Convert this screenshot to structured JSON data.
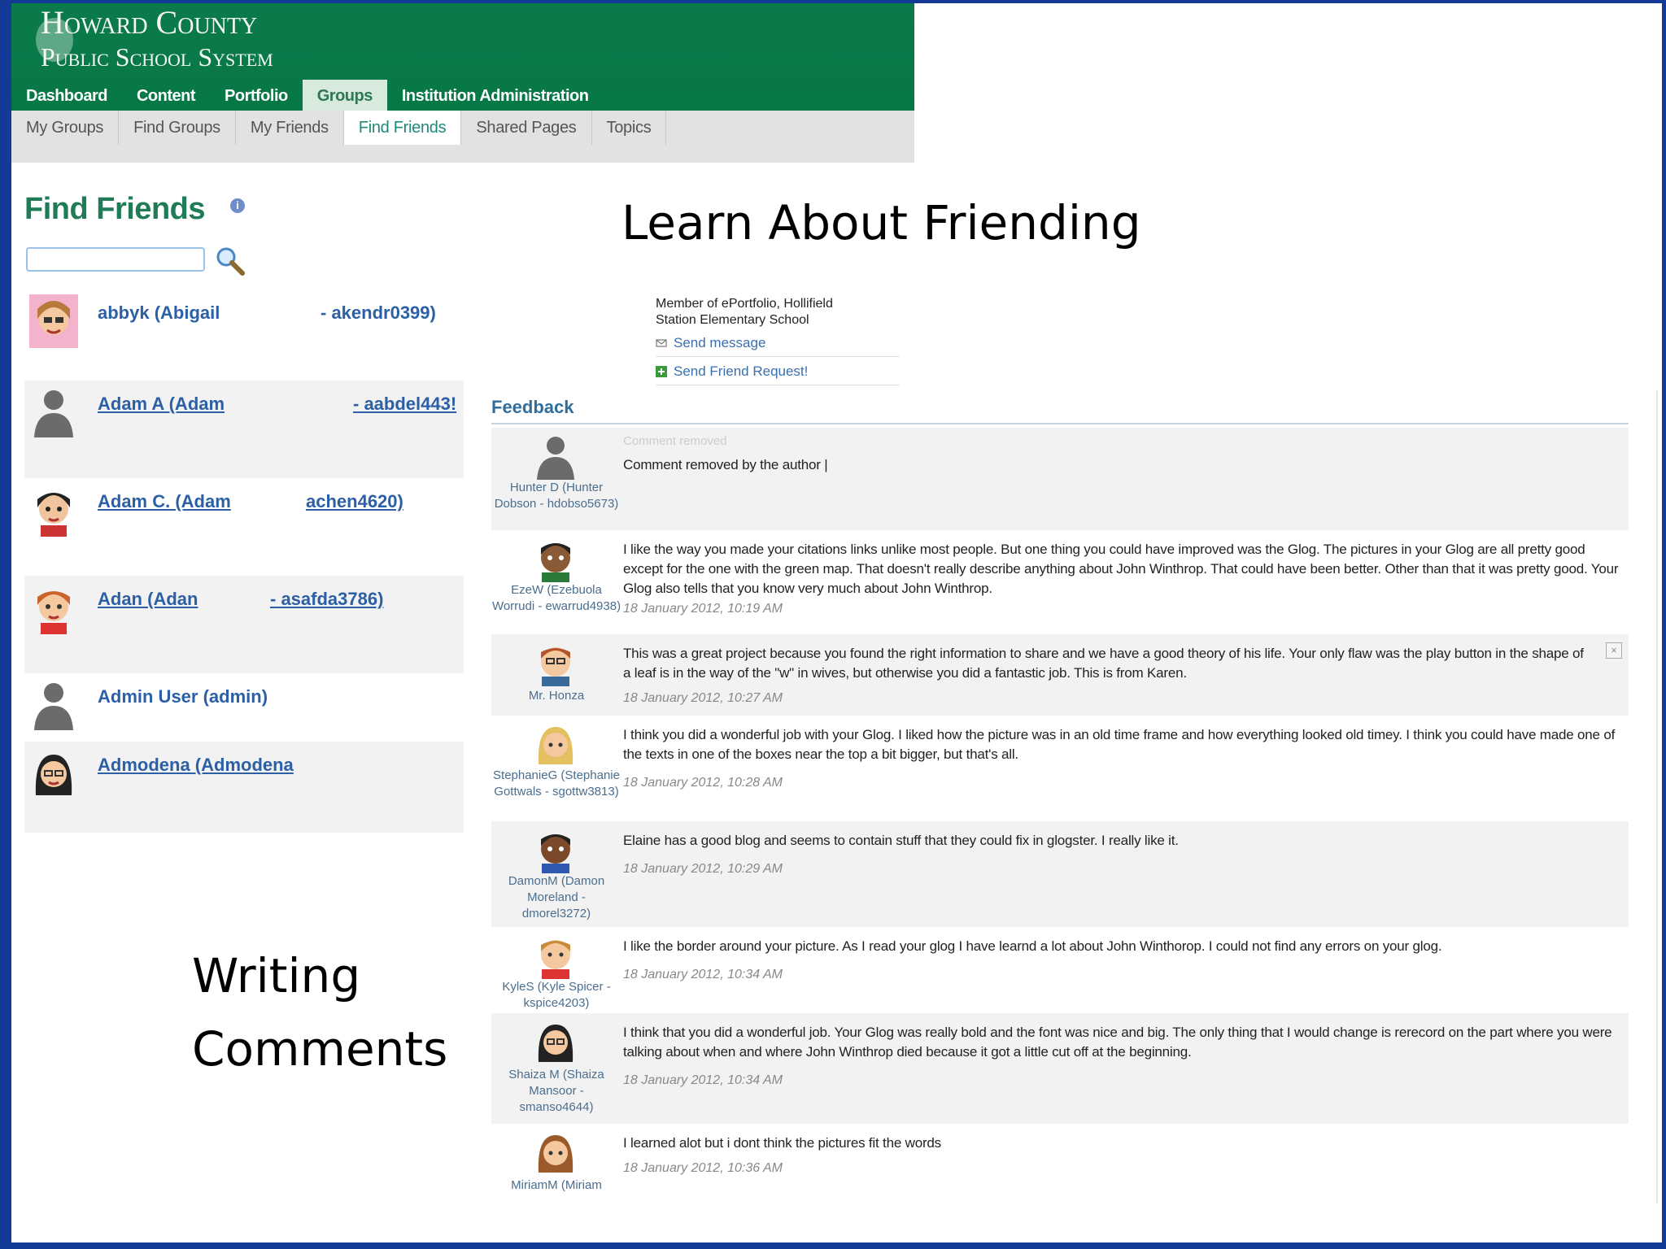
{
  "header": {
    "logo_line1": "Howard County",
    "logo_line2": "Public School System"
  },
  "main_nav": [
    "Dashboard",
    "Content",
    "Portfolio",
    "Groups",
    "Institution Administration"
  ],
  "main_nav_active": "Groups",
  "sub_nav": [
    "My Groups",
    "Find Groups",
    "My Friends",
    "Find Friends",
    "Shared Pages",
    "Topics"
  ],
  "sub_nav_active": "Find Friends",
  "page": {
    "title": "Find Friends",
    "search_placeholder": ""
  },
  "annotations": {
    "learn": "Learn About Friending",
    "writing": "Writing",
    "comments": "Comments"
  },
  "friends": [
    {
      "name": "abbyk (Abigail",
      "handle": "- akendr0399)",
      "link": false,
      "avatar": "girl-glasses"
    },
    {
      "name": "Adam A (Adam",
      "handle": "- aabdel443!",
      "link": true,
      "avatar": "silhouette"
    },
    {
      "name": "Adam C. (Adam",
      "handle": "achen4620)",
      "link": true,
      "avatar": "boy-dark"
    },
    {
      "name": "Adan (Adan",
      "handle": "- asafda3786)",
      "link": true,
      "avatar": "boy-red"
    },
    {
      "name": "Admin User (admin)",
      "handle": "",
      "link": false,
      "avatar": "silhouette"
    },
    {
      "name": "Admodena (Admodena",
      "handle": "",
      "link": true,
      "avatar": "girl-dark"
    }
  ],
  "member_panel": {
    "line1": "Member of ePortfolio, Hollifield",
    "line2": "Station Elementary School",
    "send_message": "Send message",
    "send_request": "Send Friend Request!"
  },
  "feedback": {
    "title": "Feedback",
    "comments": [
      {
        "author": "Hunter D (Hunter Dobson - hdobso5673)",
        "removed_title": "Comment removed",
        "text": "Comment removed by the author |",
        "date": "",
        "avatar": "silhouette"
      },
      {
        "author": "EzeW (Ezebuola Worrudi - ewarrud4938)",
        "removed_title": "",
        "text": "I like the way you made your citations links unlike most people. But one thing you could have improved was the Glog. The pictures in your Glog are all pretty good except for the one with the green map. That doesn't really describe anything about John Winthrop. That could have been better. Other than that it was pretty good. Your Glog also tells that you know very much about John Winthrop.",
        "date": "18 January 2012, 10:19 AM",
        "avatar": "boy-dark"
      },
      {
        "author": "Mr. Honza",
        "removed_title": "",
        "text": "This was a great project because you found the right information to share and we have a good theory of his life. Your only flaw was the play button in the shape of a leaf is in the way of the \"w\" in wives, but otherwise you did a fantastic job. This is from Karen.",
        "date": "18 January 2012, 10:27 AM",
        "avatar": "man-glasses"
      },
      {
        "author": "StephanieG (Stephanie Gottwals - sgottw3813)",
        "removed_title": "",
        "text": "I think you did a wonderful job with your Glog. I liked how the picture was in an old time frame and how everything looked old timey. I think you could have made one of the texts in one of the boxes near the top a bit bigger, but that's all.",
        "date": "18 January 2012, 10:28 AM",
        "avatar": "girl-blonde"
      },
      {
        "author": "DamonM (Damon Moreland - dmorel3272)",
        "removed_title": "",
        "text": "Elaine has a good blog and seems to contain stuff that they could fix in glogster. I really like it.",
        "date": "18 January 2012, 10:29 AM",
        "avatar": "boy-dark2"
      },
      {
        "author": "KyleS (Kyle Spicer - kspice4203)",
        "removed_title": "",
        "text": "I like the border around your picture. As I read your glog I have learnd a lot about John Winthorop. I could not find any errors on your glog.",
        "date": "18 January 2012, 10:34 AM",
        "avatar": "boy-light"
      },
      {
        "author": "Shaiza M (Shaiza Mansoor - smanso4644)",
        "removed_title": "",
        "text": "I think that you did a wonderful job. Your Glog was really bold and the font was nice and big. The only thing that I would change is rerecord on the part where you were talking about when and where John Winthrop died because it got a little cut off at the beginning.",
        "date": "18 January 2012, 10:34 AM",
        "avatar": "girl-dark"
      },
      {
        "author": "MiriamM (Miriam",
        "removed_title": "",
        "text": "I learned alot but i dont think the pictures fit the words",
        "date": "18 January 2012, 10:36 AM",
        "avatar": "girl-light"
      }
    ]
  },
  "colors": {
    "header_green": "#067845",
    "link_blue": "#2b5fa6",
    "frame_blue": "#123a96",
    "title_green": "#1f7c56"
  }
}
